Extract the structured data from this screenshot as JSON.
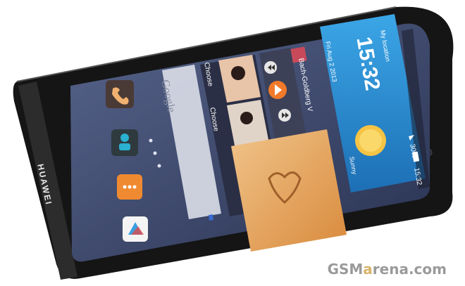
{
  "brand": "HUAWEI",
  "watermark": {
    "left": "GSM",
    "accent": "a",
    "right": "rena.com"
  },
  "status_bar": {
    "time": "15:32",
    "battery": "30%"
  },
  "search_widget": {
    "label": "Google"
  },
  "music_widget": {
    "choose_top": "Choose",
    "choose_bottom": "Choose",
    "track": "Bach-Goldberg V"
  },
  "weather_widget": {
    "location": "My location",
    "time": "15:32",
    "date": "Fri Aug 2 2013",
    "condition": "Sunny"
  },
  "colors": {
    "phone_body": "#141414",
    "screen_bg": "#3a4668",
    "weather_bg": "#2f8fd0",
    "accent": "#f07a2a"
  }
}
